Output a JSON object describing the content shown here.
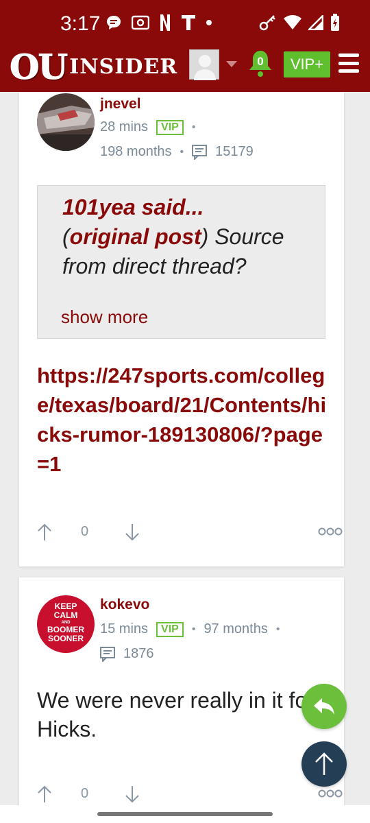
{
  "status_bar": {
    "time": "3:17",
    "icons_left": [
      "chat-bubble-icon",
      "radio-icon",
      "netflix-icon",
      "t-icon",
      "dot-icon"
    ],
    "icons_right": [
      "key-icon",
      "wifi-icon",
      "signal-icon",
      "battery-icon"
    ]
  },
  "header": {
    "logo_ou": "OU",
    "logo_insider": "INSIDER",
    "notifications_count": "0",
    "vip_label": "VIP+"
  },
  "posts": [
    {
      "username": "jnevel",
      "time": "28 mins",
      "badge": "VIP",
      "membership": "198 months",
      "post_count": "15179",
      "quote": {
        "author": "101yea said...",
        "original_open": "(",
        "original_label": "original post",
        "original_close": ")",
        "text": " Source from direct thread?",
        "show_more": "show more"
      },
      "link": "https://247sports.com/college/texas/board/21/Contents/hicks-rumor-189130806/?page=1",
      "votes": "0"
    },
    {
      "username": "kokevo",
      "time": "15 mins",
      "badge": "VIP",
      "membership": "97 months",
      "post_count": "1876",
      "avatar_text": [
        "KEEP",
        "CALM",
        "AND",
        "BOOMER",
        "SOONER"
      ],
      "body": "We were never really in it for Hicks.",
      "votes": "0"
    }
  ],
  "colors": {
    "brand": "#8a0a0a",
    "vip_green": "#6cbf3a",
    "meta_gray": "#7a8a99",
    "fab_dark": "#243e55"
  }
}
